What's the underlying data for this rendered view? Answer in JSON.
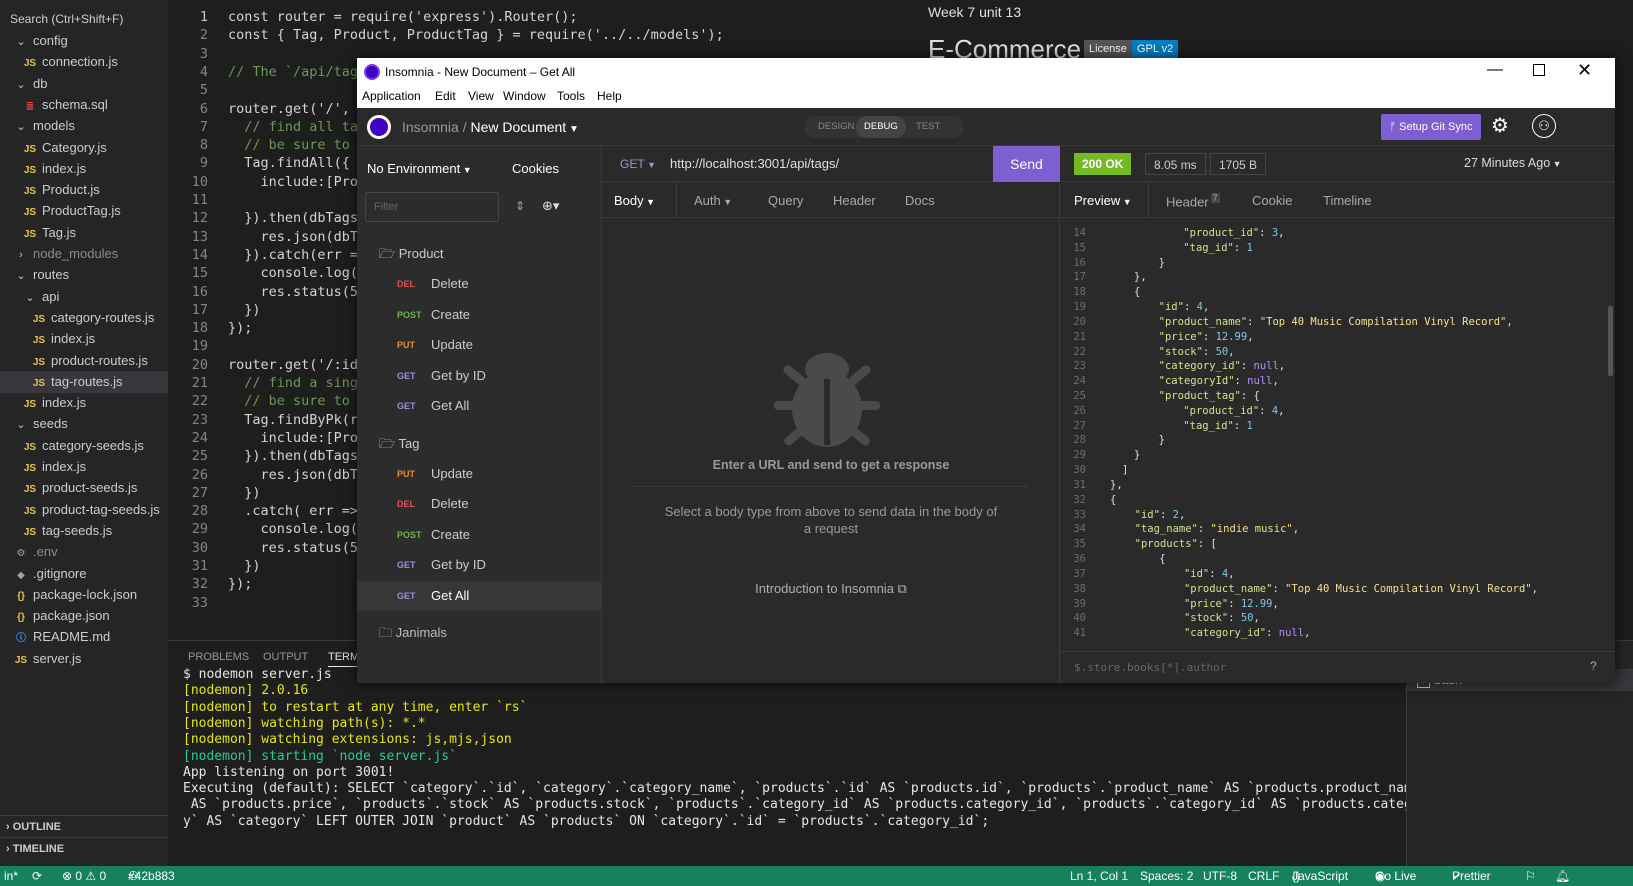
{
  "explorer": {
    "search_text": "Search (Ctrl+Shift+F)",
    "items": [
      {
        "icon": "chevron-down",
        "label": "config",
        "indent": 1
      },
      {
        "icon": "js",
        "label": "connection.js",
        "indent": 2
      },
      {
        "icon": "chevron-down",
        "label": "db",
        "indent": 1
      },
      {
        "icon": "db",
        "label": "schema.sql",
        "indent": 2
      },
      {
        "icon": "chevron-down",
        "label": "models",
        "indent": 1
      },
      {
        "icon": "js",
        "label": "Category.js",
        "indent": 2
      },
      {
        "icon": "js",
        "label": "index.js",
        "indent": 2
      },
      {
        "icon": "js",
        "label": "Product.js",
        "indent": 2
      },
      {
        "icon": "js",
        "label": "ProductTag.js",
        "indent": 2
      },
      {
        "icon": "js",
        "label": "Tag.js",
        "indent": 2
      },
      {
        "icon": "chevron-right",
        "label": "node_modules",
        "indent": 1,
        "dim": true
      },
      {
        "icon": "chevron-down",
        "label": "routes",
        "indent": 1
      },
      {
        "icon": "chevron-down",
        "label": "api",
        "indent": 2
      },
      {
        "icon": "js",
        "label": "category-routes.js",
        "indent": 3
      },
      {
        "icon": "js",
        "label": "index.js",
        "indent": 3
      },
      {
        "icon": "js",
        "label": "product-routes.js",
        "indent": 3
      },
      {
        "icon": "js",
        "label": "tag-routes.js",
        "indent": 3,
        "selected": true
      },
      {
        "icon": "js",
        "label": "index.js",
        "indent": 2
      },
      {
        "icon": "chevron-down",
        "label": "seeds",
        "indent": 1
      },
      {
        "icon": "js",
        "label": "category-seeds.js",
        "indent": 2
      },
      {
        "icon": "js",
        "label": "index.js",
        "indent": 2
      },
      {
        "icon": "js",
        "label": "product-seeds.js",
        "indent": 2
      },
      {
        "icon": "js",
        "label": "product-tag-seeds.js",
        "indent": 2
      },
      {
        "icon": "js",
        "label": "tag-seeds.js",
        "indent": 2
      },
      {
        "icon": "gear",
        "label": ".env",
        "indent": 1,
        "dim": true
      },
      {
        "icon": "git",
        "label": ".gitignore",
        "indent": 1
      },
      {
        "icon": "json",
        "label": "package-lock.json",
        "indent": 1
      },
      {
        "icon": "json",
        "label": "package.json",
        "indent": 1
      },
      {
        "icon": "info",
        "label": "README.md",
        "indent": 1
      },
      {
        "icon": "js",
        "label": "server.js",
        "indent": 1
      }
    ],
    "outline_label": "OUTLINE",
    "timeline_label": "TIMELINE"
  },
  "editor": {
    "lines": [
      {
        "n": "1",
        "t": "const router = require('express').Router();"
      },
      {
        "n": "2",
        "t": "const { Tag, Product, ProductTag } = require('../../models');"
      },
      {
        "n": "3",
        "t": ""
      },
      {
        "n": "4",
        "t": "// The `/api/tag"
      },
      {
        "n": "5",
        "t": ""
      },
      {
        "n": "6",
        "t": "router.get('/',"
      },
      {
        "n": "7",
        "t": "  // find all ta"
      },
      {
        "n": "8",
        "t": "  // be sure to"
      },
      {
        "n": "9",
        "t": "  Tag.findAll({"
      },
      {
        "n": "10",
        "t": "    include:[Pro"
      },
      {
        "n": "11",
        "t": ""
      },
      {
        "n": "12",
        "t": "  }).then(dbTags"
      },
      {
        "n": "13",
        "t": "    res.json(dbT"
      },
      {
        "n": "14",
        "t": "  }).catch(err ="
      },
      {
        "n": "15",
        "t": "    console.log("
      },
      {
        "n": "16",
        "t": "    res.status(5"
      },
      {
        "n": "17",
        "t": "  })"
      },
      {
        "n": "18",
        "t": "});"
      },
      {
        "n": "19",
        "t": ""
      },
      {
        "n": "20",
        "t": "router.get('/:id"
      },
      {
        "n": "21",
        "t": "  // find a sing"
      },
      {
        "n": "22",
        "t": "  // be sure to"
      },
      {
        "n": "23",
        "t": "  Tag.findByPk(r"
      },
      {
        "n": "24",
        "t": "    include:[Pro"
      },
      {
        "n": "25",
        "t": "  }).then(dbTags"
      },
      {
        "n": "26",
        "t": "    res.json(dbT"
      },
      {
        "n": "27",
        "t": "  })"
      },
      {
        "n": "28",
        "t": "  .catch( err =>"
      },
      {
        "n": "29",
        "t": "    console.log("
      },
      {
        "n": "30",
        "t": "    res.status(5"
      },
      {
        "n": "31",
        "t": "  })"
      },
      {
        "n": "32",
        "t": "});"
      },
      {
        "n": "33",
        "t": ""
      }
    ]
  },
  "readme": {
    "heading": "Week 7 unit 13",
    "title": "E-Commerce",
    "badge_left": "License",
    "badge_right": "GPL v2"
  },
  "panel": {
    "tabs": [
      "PROBLEMS",
      "OUTPUT",
      "TERM"
    ],
    "terminal_lines": [
      {
        "t": "$ nodemon server.js",
        "c": ""
      },
      {
        "t": "[nodemon] 2.0.16",
        "c": "yellow"
      },
      {
        "t": "[nodemon] to restart at any time, enter `rs`",
        "c": "yellow"
      },
      {
        "t": "[nodemon] watching path(s): *.*",
        "c": "yellow"
      },
      {
        "t": "[nodemon] watching extensions: js,mjs,json",
        "c": "yellow"
      },
      {
        "t": "[nodemon] starting `node server.js`",
        "c": "green"
      },
      {
        "t": "App listening on port 3001!",
        "c": ""
      },
      {
        "t": "Executing (default): SELECT `category`.`id`, `category`.`category_name`, `products`.`id` AS `products.id`, `products`.`product_name` AS `products.product_name`, `products`.`price",
        "c": ""
      },
      {
        "t": " AS `products.price`, `products`.`stock` AS `products.stock`, `products`.`category_id` AS `products.category_id`, `products`.`category_id` AS `products.categoryId` FROM `categor",
        "c": ""
      },
      {
        "t": "y` AS `category` LEFT OUTER JOIN `product` AS `products` ON `category`.`id` = `products`.`category_id`;",
        "c": ""
      }
    ],
    "terminals": [
      "bash",
      "bash"
    ]
  },
  "statusbar": {
    "branch_hint": "in*",
    "problems": "⊗ 0 ⚠ 0",
    "commit": "#42b883",
    "position": "Ln 1, Col 1",
    "spaces": "Spaces: 2",
    "encoding": "UTF-8",
    "eol": "CRLF",
    "language": "JavaScript",
    "golive": "Go Live",
    "prettier": "Prettier"
  },
  "insomnia": {
    "window_title": "Insomnia - New Document – Get All",
    "menu": [
      "Application",
      "Edit",
      "View",
      "Window",
      "Tools",
      "Help"
    ],
    "breadcrumb_root": "Insomnia",
    "breadcrumb_doc": "New Document",
    "modes": [
      "DESIGN",
      "DEBUG",
      "TEST"
    ],
    "active_mode": "DEBUG",
    "git_sync_label": "Setup Git Sync",
    "environment": "No Environment",
    "cookies": "Cookies",
    "filter_placeholder": "Filter",
    "folders": [
      {
        "name": "Product",
        "open": true,
        "requests": [
          {
            "method": "DEL",
            "name": "Delete"
          },
          {
            "method": "POST",
            "name": "Create"
          },
          {
            "method": "PUT",
            "name": "Update"
          },
          {
            "method": "GET",
            "name": "Get by ID"
          },
          {
            "method": "GET",
            "name": "Get All"
          }
        ]
      },
      {
        "name": "Tag",
        "open": true,
        "requests": [
          {
            "method": "PUT",
            "name": "Update"
          },
          {
            "method": "DEL",
            "name": "Delete"
          },
          {
            "method": "POST",
            "name": "Create"
          },
          {
            "method": "GET",
            "name": "Get by ID"
          },
          {
            "method": "GET",
            "name": "Get All",
            "active": true
          }
        ]
      },
      {
        "name": "Janimals",
        "open": false,
        "requests": []
      }
    ],
    "request": {
      "method": "GET",
      "url": "http://localhost:3001/api/tags/",
      "send_label": "Send",
      "tabs": [
        "Body",
        "Auth",
        "Query",
        "Header",
        "Docs"
      ],
      "empty_title": "Enter a URL and send to get a response",
      "empty_body": "Select a body type from above to send data in the body of a request",
      "intro_link": "Introduction to Insomnia"
    },
    "response": {
      "status": "200 OK",
      "time": "8.05 ms",
      "size": "1705 B",
      "ago": "27 Minutes Ago",
      "tabs": [
        "Preview",
        "Header",
        "Cookie",
        "Timeline"
      ],
      "header_count": "7",
      "filter_placeholder": "$.store.books[*].author",
      "status_color": "#75ba24",
      "json_lines": [
        {
          "n": "14",
          "t": [
            [
              "    ",
              ""
            ],
            [
              "\"product_id\"",
              "jk"
            ],
            [
              ": ",
              ""
            ],
            [
              "3",
              "jn"
            ],
            [
              ",",
              ""
            ]
          ]
        },
        {
          "n": "15",
          "t": [
            [
              "    ",
              ""
            ],
            [
              "\"tag_id\"",
              "jk"
            ],
            [
              ": ",
              ""
            ],
            [
              "1",
              "jn"
            ]
          ]
        },
        {
          "n": "16",
          "t": [
            [
              "  }",
              ""
            ]
          ]
        },
        {
          "n": "17",
          "t": [
            [
              "},",
              ""
            ]
          ]
        },
        {
          "n": "18",
          "t": [
            [
              "{",
              ""
            ]
          ]
        },
        {
          "n": "19",
          "t": [
            [
              "  ",
              ""
            ],
            [
              "\"id\"",
              "jk"
            ],
            [
              ": ",
              ""
            ],
            [
              "4",
              "jn"
            ],
            [
              ",",
              ""
            ]
          ]
        },
        {
          "n": "20",
          "t": [
            [
              "  ",
              ""
            ],
            [
              "\"product_name\"",
              "jk"
            ],
            [
              ": ",
              ""
            ],
            [
              "\"Top 40 Music Compilation Vinyl Record\"",
              "js"
            ],
            [
              ",",
              ""
            ]
          ]
        },
        {
          "n": "21",
          "t": [
            [
              "  ",
              ""
            ],
            [
              "\"price\"",
              "jk"
            ],
            [
              ": ",
              ""
            ],
            [
              "12.99",
              "jn"
            ],
            [
              ",",
              ""
            ]
          ]
        },
        {
          "n": "22",
          "t": [
            [
              "  ",
              ""
            ],
            [
              "\"stock\"",
              "jk"
            ],
            [
              ": ",
              ""
            ],
            [
              "50",
              "jn"
            ],
            [
              ",",
              ""
            ]
          ]
        },
        {
          "n": "23",
          "t": [
            [
              "  ",
              ""
            ],
            [
              "\"category_id\"",
              "jk"
            ],
            [
              ": ",
              ""
            ],
            [
              "null",
              "jnull"
            ],
            [
              ",",
              ""
            ]
          ]
        },
        {
          "n": "24",
          "t": [
            [
              "  ",
              ""
            ],
            [
              "\"categoryId\"",
              "jk"
            ],
            [
              ": ",
              ""
            ],
            [
              "null",
              "jnull"
            ],
            [
              ",",
              ""
            ]
          ]
        },
        {
          "n": "25",
          "t": [
            [
              "  ",
              ""
            ],
            [
              "\"product_tag\"",
              "jk"
            ],
            [
              ": {",
              ""
            ]
          ]
        },
        {
          "n": "26",
          "t": [
            [
              "    ",
              ""
            ],
            [
              "\"product_id\"",
              "jk"
            ],
            [
              ": ",
              ""
            ],
            [
              "4",
              "jn"
            ],
            [
              ",",
              ""
            ]
          ]
        },
        {
          "n": "27",
          "t": [
            [
              "    ",
              ""
            ],
            [
              "\"tag_id\"",
              "jk"
            ],
            [
              ": ",
              ""
            ],
            [
              "1",
              "jn"
            ]
          ]
        },
        {
          "n": "28",
          "t": [
            [
              "  }",
              ""
            ]
          ]
        },
        {
          "n": "29",
          "t": [
            [
              "}",
              ""
            ]
          ]
        },
        {
          "n": "30",
          "t": [
            [
              "]",
              ""
            ]
          ]
        },
        {
          "n": "31",
          "t": [
            [
              "},",
              ""
            ]
          ]
        },
        {
          "n": "32",
          "t": [
            [
              "{",
              ""
            ]
          ]
        },
        {
          "n": "33",
          "t": [
            [
              "  ",
              ""
            ],
            [
              "\"id\"",
              "jk"
            ],
            [
              ": ",
              ""
            ],
            [
              "2",
              "jn"
            ],
            [
              ",",
              ""
            ]
          ]
        },
        {
          "n": "34",
          "t": [
            [
              "  ",
              ""
            ],
            [
              "\"tag_name\"",
              "jk"
            ],
            [
              ": ",
              ""
            ],
            [
              "\"indie music\"",
              "js"
            ],
            [
              ",",
              ""
            ]
          ]
        },
        {
          "n": "35",
          "t": [
            [
              "  ",
              ""
            ],
            [
              "\"products\"",
              "jk"
            ],
            [
              ": [",
              ""
            ]
          ]
        },
        {
          "n": "36",
          "t": [
            [
              "    {",
              ""
            ]
          ]
        },
        {
          "n": "37",
          "t": [
            [
              "      ",
              ""
            ],
            [
              "\"id\"",
              "jk"
            ],
            [
              ": ",
              ""
            ],
            [
              "4",
              "jn"
            ],
            [
              ",",
              ""
            ]
          ]
        },
        {
          "n": "38",
          "t": [
            [
              "      ",
              ""
            ],
            [
              "\"product_name\"",
              "jk"
            ],
            [
              ": ",
              ""
            ],
            [
              "\"Top 40 Music Compilation Vinyl Record\"",
              "js"
            ],
            [
              ",",
              ""
            ]
          ]
        },
        {
          "n": "39",
          "t": [
            [
              "      ",
              ""
            ],
            [
              "\"price\"",
              "jk"
            ],
            [
              ": ",
              ""
            ],
            [
              "12.99",
              "jn"
            ],
            [
              ",",
              ""
            ]
          ]
        },
        {
          "n": "40",
          "t": [
            [
              "      ",
              ""
            ],
            [
              "\"stock\"",
              "jk"
            ],
            [
              ": ",
              ""
            ],
            [
              "50",
              "jn"
            ],
            [
              ",",
              ""
            ]
          ]
        },
        {
          "n": "41",
          "t": [
            [
              "      ",
              ""
            ],
            [
              "\"category_id\"",
              "jk"
            ],
            [
              ": ",
              ""
            ],
            [
              "null",
              "jnull"
            ],
            [
              ",",
              ""
            ]
          ]
        }
      ]
    }
  }
}
